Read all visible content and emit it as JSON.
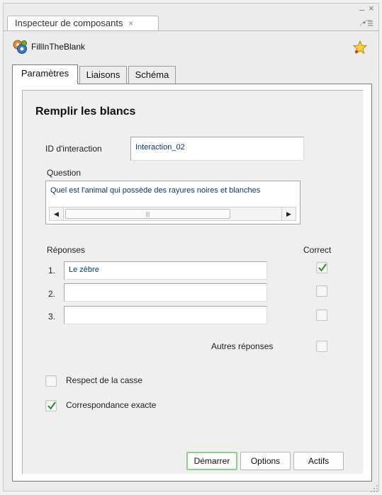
{
  "panel": {
    "title": "Inspecteur de composants",
    "tab_close": "×",
    "minimize": "–",
    "close": "×"
  },
  "component": {
    "name": "FillInTheBlank",
    "icon": "component-gears-icon",
    "favorite_icon": "star-icon"
  },
  "tabs": [
    {
      "label": "Paramètres",
      "active": true
    },
    {
      "label": "Liaisons",
      "active": false
    },
    {
      "label": "Schéma",
      "active": false
    }
  ],
  "form": {
    "title": "Remplir les blancs",
    "interaction_id_label": "ID d'interaction",
    "interaction_id_value": "Interaction_02",
    "question_label": "Question",
    "question_value": "Quel est l'animal qui possède des rayures noires et blanches",
    "answers_label": "Réponses",
    "correct_label": "Correct",
    "answers": [
      {
        "number": "1.",
        "value": "Le zèbre",
        "correct": true
      },
      {
        "number": "2.",
        "value": "",
        "correct": false
      },
      {
        "number": "3.",
        "value": "",
        "correct": false
      }
    ],
    "other_answers_label": "Autres réponses",
    "other_answers_checked": false,
    "case_sensitive_label": "Respect de la casse",
    "case_sensitive_checked": false,
    "exact_match_label": "Correspondance exacte",
    "exact_match_checked": true
  },
  "buttons": {
    "start": "Démarrer",
    "options": "Options",
    "assets": "Actifs"
  },
  "colors": {
    "accent_focus": "#8dd08d",
    "check": "#2f8a2f",
    "input_text": "#0a3a6a"
  }
}
